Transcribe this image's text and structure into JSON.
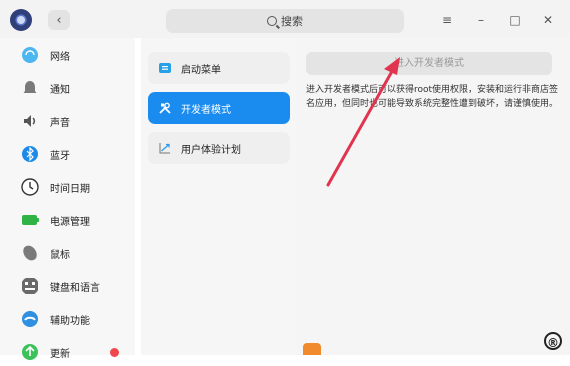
{
  "header": {
    "search_text": "搜索",
    "controls": {
      "menu": "≡",
      "minimize": "–",
      "maximize": "□",
      "close": "✕"
    }
  },
  "sidebar": {
    "items": [
      {
        "label": "网络",
        "icon": "network-icon",
        "color": "#4bb6f0"
      },
      {
        "label": "通知",
        "icon": "bell-icon",
        "color": "#7a7a7a"
      },
      {
        "label": "声音",
        "icon": "speaker-icon",
        "color": "#555555"
      },
      {
        "label": "蓝牙",
        "icon": "bluetooth-icon",
        "color": "#1e8ae8"
      },
      {
        "label": "时间日期",
        "icon": "clock-icon",
        "color": "#ffffff"
      },
      {
        "label": "电源管理",
        "icon": "battery-icon",
        "color": "#2fb344"
      },
      {
        "label": "鼠标",
        "icon": "mouse-icon",
        "color": "#7a7a7a"
      },
      {
        "label": "键盘和语言",
        "icon": "keyboard-icon",
        "color": "#6a6a6a"
      },
      {
        "label": "辅助功能",
        "icon": "accessibility-icon",
        "color": "#2f8fe0"
      },
      {
        "label": "更新",
        "icon": "update-icon",
        "color": "#3cc25a"
      }
    ]
  },
  "middle": {
    "items": [
      {
        "label": "启动菜单",
        "icon": "boot-menu-icon"
      },
      {
        "label": "开发者模式",
        "icon": "developer-tools-icon",
        "active": true
      },
      {
        "label": "用户体验计划",
        "icon": "chart-trend-icon"
      }
    ]
  },
  "content": {
    "button_label": "进入开发者模式",
    "description": "进入开发者模式后可以获得root使用权限，安装和运行非商店签名应用，但同时也可能导致系统完整性遭到破坏，请谨慎使用。"
  },
  "colors": {
    "accent": "#1a8cf0",
    "arrow": "#e0344f",
    "badge": "#f0474c"
  }
}
